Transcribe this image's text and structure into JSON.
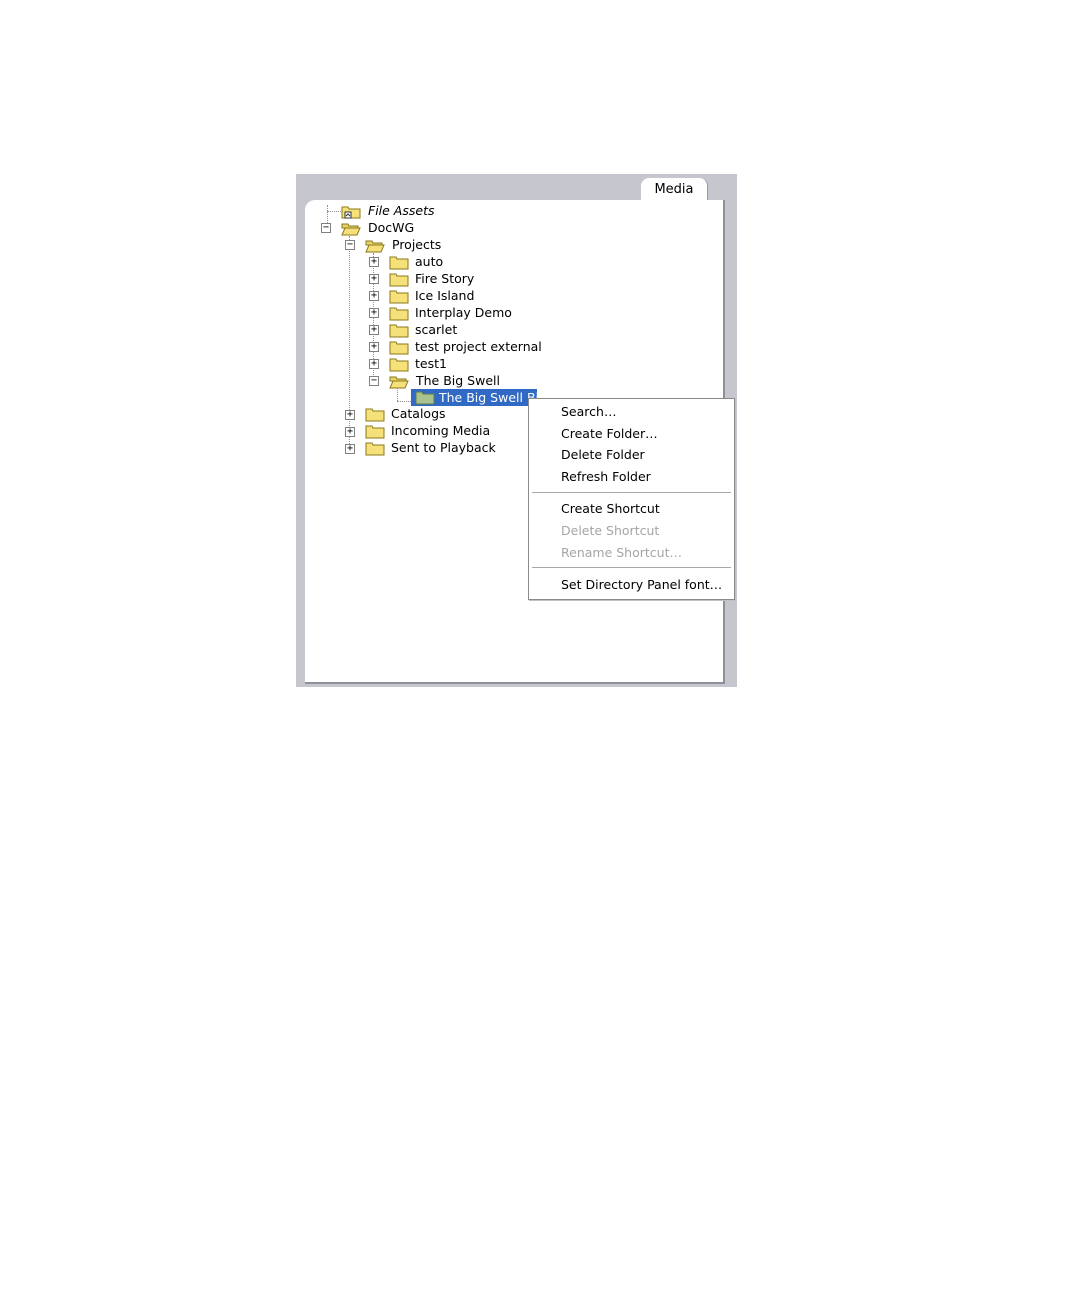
{
  "panel": {
    "tab_label": "Media"
  },
  "tree": {
    "items": [
      {
        "label": "File Assets",
        "style": "italic"
      },
      {
        "label": "DocWG",
        "expanded": true
      },
      {
        "label": "Projects",
        "expanded": true
      },
      {
        "label": "auto",
        "expanded": false
      },
      {
        "label": "Fire Story",
        "expanded": false
      },
      {
        "label": "Ice Island",
        "expanded": false
      },
      {
        "label": "Interplay Demo",
        "expanded": false
      },
      {
        "label": "scarlet",
        "expanded": false
      },
      {
        "label": "test project external",
        "expanded": false
      },
      {
        "label": "test1",
        "expanded": false
      },
      {
        "label": "The Big Swell",
        "expanded": true
      },
      {
        "label": "The Big Swell Bin",
        "selected": true
      },
      {
        "label": "Catalogs",
        "expanded": false
      },
      {
        "label": "Incoming Media",
        "expanded": false
      },
      {
        "label": "Sent to Playback",
        "expanded": false
      }
    ],
    "expand_glyph": "+",
    "collapse_glyph": "−"
  },
  "context_menu": {
    "items": [
      {
        "label": "Search…",
        "enabled": true
      },
      {
        "label": "Create Folder…",
        "enabled": true
      },
      {
        "label": "Delete Folder",
        "enabled": true
      },
      {
        "label": "Refresh Folder",
        "enabled": true
      },
      {
        "label": "Create Shortcut",
        "enabled": true
      },
      {
        "label": "Delete Shortcut",
        "enabled": false
      },
      {
        "label": "Rename Shortcut…",
        "enabled": false
      },
      {
        "label": "Set Directory Panel font…",
        "enabled": true
      }
    ]
  },
  "colors": {
    "selection": "#316ac5",
    "folder_fill": "#f5e07a",
    "folder_stroke": "#8a7a1a",
    "disabled_text": "#a5a5a5",
    "frame_background": "#c6c6ce"
  }
}
